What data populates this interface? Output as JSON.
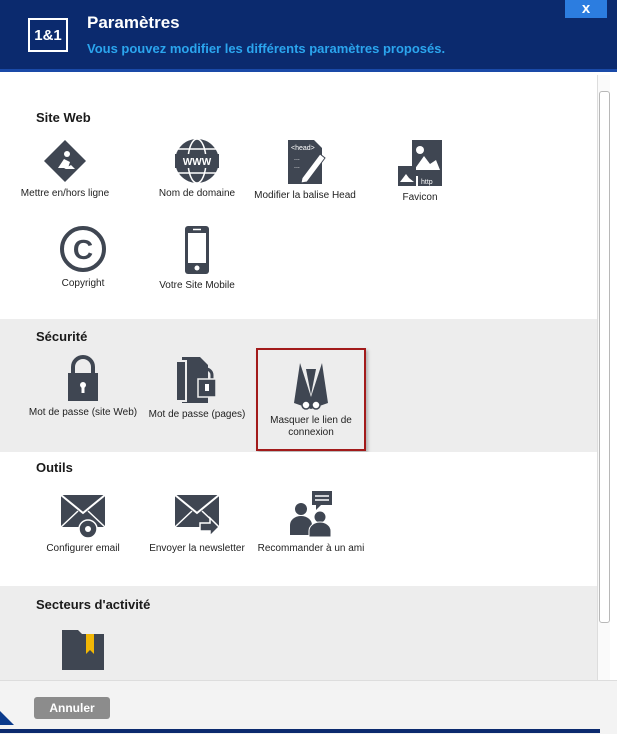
{
  "header": {
    "logo": "1&1",
    "title": "Paramètres",
    "subtitle": "Vous pouvez modifier les différents paramètres proposés.",
    "close": "x"
  },
  "sections": {
    "site_web": {
      "title": "Site Web",
      "items": [
        {
          "label": "Mettre en/hors ligne",
          "icon": "construction-sign-icon"
        },
        {
          "label": "Nom de domaine",
          "icon": "globe-www-icon"
        },
        {
          "label": "Modifier la balise Head",
          "icon": "code-edit-icon"
        },
        {
          "label": "Favicon",
          "icon": "image-http-icon"
        },
        {
          "label": "Copyright",
          "icon": "copyright-icon"
        },
        {
          "label": "Votre Site Mobile",
          "icon": "mobile-phone-icon"
        }
      ]
    },
    "securite": {
      "title": "Sécurité",
      "items": [
        {
          "label": "Mot de passe (site Web)",
          "icon": "padlock-icon"
        },
        {
          "label": "Mot de passe (pages)",
          "icon": "pages-lock-icon"
        },
        {
          "label": "Masquer le lien de connexion",
          "icon": "spy-icon"
        }
      ]
    },
    "outils": {
      "title": "Outils",
      "items": [
        {
          "label": "Configurer email",
          "icon": "mail-gear-icon"
        },
        {
          "label": "Envoyer la newsletter",
          "icon": "mail-send-icon"
        },
        {
          "label": "Recommander à un ami",
          "icon": "recommend-icon"
        }
      ]
    },
    "secteurs": {
      "title": "Secteurs d'activité",
      "items": [
        {
          "label": "",
          "icon": "folder-bookmark-icon"
        }
      ]
    }
  },
  "footer": {
    "cancel": "Annuler"
  },
  "colors": {
    "header": "#0b2a6e",
    "accent": "#2ba5ee",
    "highlight_border": "#a21a1a",
    "icon": "#3f4652",
    "bookmark": "#f2b705"
  }
}
